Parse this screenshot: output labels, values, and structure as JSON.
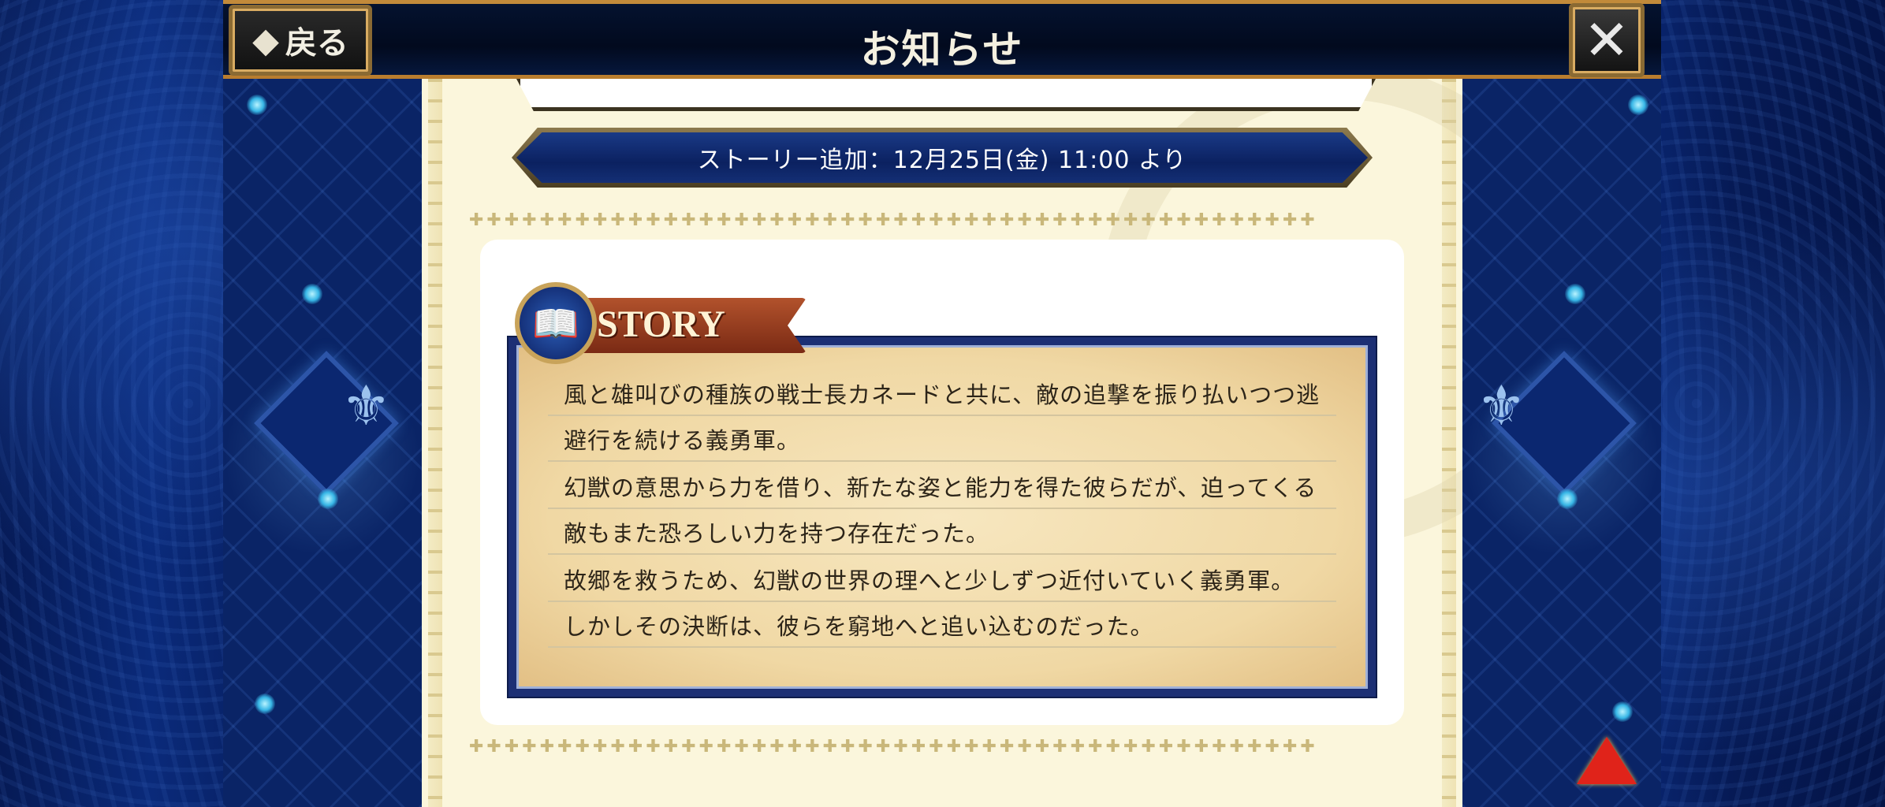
{
  "header": {
    "title": "お知らせ",
    "back_label": "戻る",
    "back_arrow_icon": "left-arrow-icon",
    "close_icon": "close-icon"
  },
  "banner": {
    "date_text": "ストーリー追加：12月25日(金) 11:00 より"
  },
  "story": {
    "badge_label": "STORY",
    "badge_icon": "book-icon",
    "lines": [
      "風と雄叫びの種族の戦士長カネードと共に、敵の追撃を振り払いつつ逃",
      "避行を続ける義勇軍。",
      "幻獣の意思から力を借り、新たな姿と能力を得た彼らだが、迫ってくる",
      "敵もまた恐ろしい力を持つ存在だった。",
      "故郷を救うため、幻獣の世界の理へと少しずつ近付いていく義勇軍。",
      "しかしその決断は、彼らを窮地へと追い込むのだった。"
    ]
  },
  "scroll_up_icon": "up-arrow-icon",
  "colors": {
    "header_bg": "#020a1e",
    "gold_border": "#c28a3a",
    "parchment": "#fbf6dc",
    "navy": "#1c2f74",
    "accent_red": "#e0231a"
  }
}
